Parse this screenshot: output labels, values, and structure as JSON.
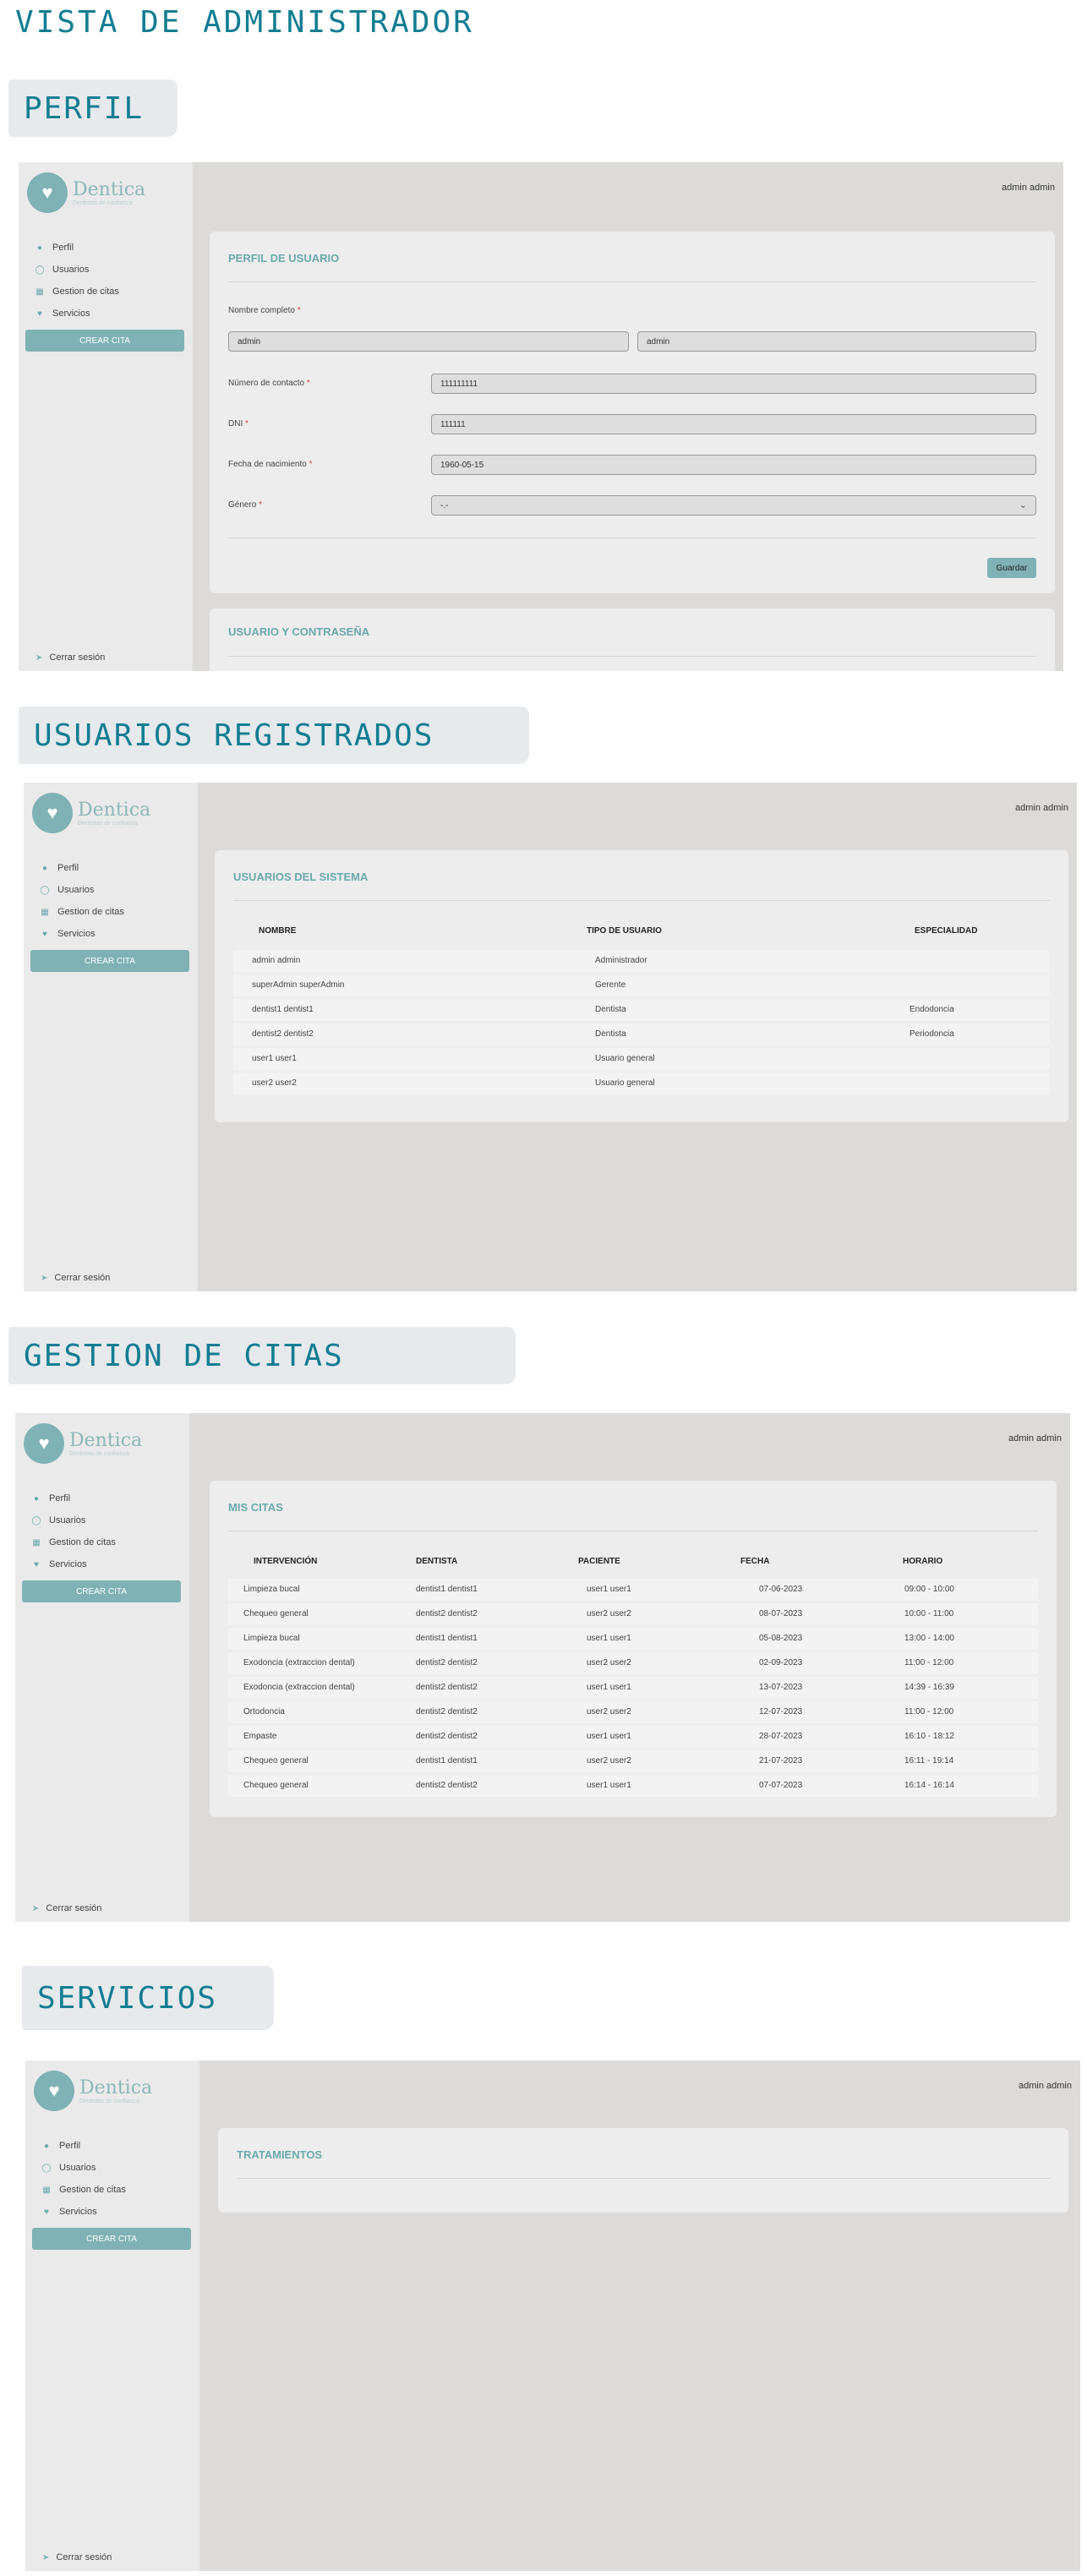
{
  "page": {
    "title": "VISTA DE ADMINISTRADOR",
    "sections": [
      "PERFIL",
      "USUARIOS REGISTRADOS",
      "GESTION DE CITAS",
      "SERVICIOS"
    ]
  },
  "app": {
    "brand": "Dentica",
    "tagline": "Dentistas de confianza",
    "user": "admin admin",
    "nav": [
      "Perfil",
      "Usuarios",
      "Gestion de citas",
      "Servicios"
    ],
    "nav_icons": [
      "user-icon",
      "eye-icon",
      "calendar-icon",
      "heart-icon"
    ],
    "create_label": "CREAR CITA",
    "logout_label": "Cerrar sesión",
    "colors": {
      "accent": "#7fb2b4",
      "title": "#127d92",
      "frame": "#dcdbda"
    }
  },
  "perfil": {
    "card_title": "PERFIL DE USUARIO",
    "name_label": "Nombre completo",
    "first_name": "admin",
    "last_name": "admin",
    "contact_label": "Número de contacto",
    "contact": "111111111",
    "dni_label": "DNI",
    "dni": "111111",
    "birth_label": "Fecha de nacimiento",
    "birth": "1960-05-15",
    "gender_label": "Género",
    "gender": "-.-",
    "required_mark": "*",
    "save": "Guardar",
    "second_card": "USUARIO Y CONTRASEÑA"
  },
  "usuarios": {
    "card_title": "USUARIOS DEL SISTEMA",
    "headers": [
      "NOMBRE",
      "TIPO DE USUARIO",
      "ESPECIALIDAD"
    ],
    "rows": [
      [
        "admin admin",
        "Administrador",
        ""
      ],
      [
        "superAdmin superAdmin",
        "Gerente",
        ""
      ],
      [
        "dentist1 dentist1",
        "Dentista",
        "Endodoncia"
      ],
      [
        "dentist2 dentist2",
        "Dentista",
        "Periodoncia"
      ],
      [
        "user1 user1",
        "Usuario general",
        ""
      ],
      [
        "user2 user2",
        "Usuario general",
        ""
      ]
    ]
  },
  "citas": {
    "card_title": "MIS CITAS",
    "headers": [
      "INTERVENCIÓN",
      "DENTISTA",
      "PACIENTE",
      "FECHA",
      "HORARIO"
    ],
    "rows": [
      [
        "Limpieza bucal",
        "dentist1 dentist1",
        "user1 user1",
        "07-06-2023",
        "09:00 - 10:00"
      ],
      [
        "Chequeo general",
        "dentist2 dentist2",
        "user2 user2",
        "08-07-2023",
        "10:00 - 11:00"
      ],
      [
        "Limpieza bucal",
        "dentist1 dentist1",
        "user1 user1",
        "05-08-2023",
        "13:00 - 14:00"
      ],
      [
        "Exodoncia (extraccion dental)",
        "dentist2 dentist2",
        "user2 user2",
        "02-09-2023",
        "11:00 - 12:00"
      ],
      [
        "Exodoncia (extraccion dental)",
        "dentist2 dentist2",
        "user1 user1",
        "13-07-2023",
        "14:39 - 16:39"
      ],
      [
        "Ortodoncia",
        "dentist2 dentist2",
        "user2 user2",
        "12-07-2023",
        "11:00 - 12:00"
      ],
      [
        "Empaste",
        "dentist2 dentist2",
        "user1 user1",
        "28-07-2023",
        "16:10 - 18:12"
      ],
      [
        "Chequeo general",
        "dentist1 dentist1",
        "user2 user2",
        "21-07-2023",
        "16:11 - 19:14"
      ],
      [
        "Chequeo general",
        "dentist2 dentist2",
        "user1 user1",
        "07-07-2023",
        "16:14 - 16:14"
      ]
    ]
  },
  "servicios": {
    "card_title": "TRATAMIENTOS"
  }
}
